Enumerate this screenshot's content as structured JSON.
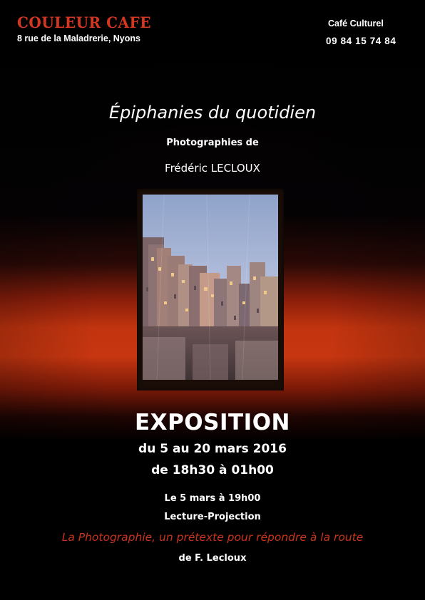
{
  "venue": {
    "name": "COULEUR CAFE",
    "address": "8 rue de la Maladrerie, Nyons",
    "type": "Café Culturel",
    "phone": "09 84 15 74 84"
  },
  "exhibition": {
    "title": "Épiphanies du quotidien",
    "subtitle": "Photographies de",
    "author": "Frédéric LECLOUX",
    "label": "EXPOSITION",
    "dates": "du 5 au 20 mars 2016",
    "hours": "de 18h30 à 01h00"
  },
  "event": {
    "date": "Le 5 mars à 19h00",
    "type": "Lecture-Projection",
    "title": "La Photographie, un prétexte pour répondre à la route",
    "by": "de F. Lecloux"
  },
  "colors": {
    "accent_red": "#d5361f",
    "background": "#000000",
    "band_orange": "#c2340f"
  }
}
